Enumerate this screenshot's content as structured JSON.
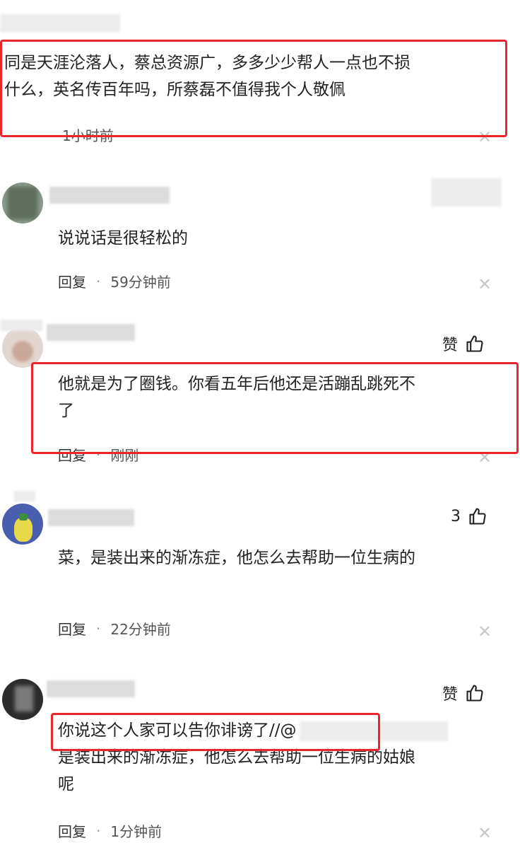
{
  "comments": [
    {
      "text": "同是天涯沦落人，蔡总资源广，多多少少帮人一点也不损什么，英名传百年吗，所蔡磊不值得我个人敬佩",
      "line1": "同是天涯沦落人，蔡总资源广，多多少少帮人一点也不损",
      "line2": "什么，英名传百年吗，所蔡磊不值得我个人敬佩",
      "time": "1小时前",
      "highlighted": true
    },
    {
      "text": "说说话是很轻松的",
      "reply": "回复",
      "time": "59分钟前"
    },
    {
      "like_label": "赞",
      "line1": "他就是为了圈钱。你看五年后他还是活蹦乱跳死不",
      "line2": "了",
      "reply": "回复",
      "time": "刚刚",
      "highlighted": true
    },
    {
      "like_count": "3",
      "text": "菜，是装出来的渐冻症，他怎么去帮助一位生病的",
      "reply": "回复",
      "time": "22分钟前"
    },
    {
      "like_label": "赞",
      "reply_prefix": "你说这个人家可以告你诽谤了//@",
      "line2": "是装出来的渐冻症，他怎么去帮助一位生病的姑娘",
      "line3": "呢",
      "reply": "回复",
      "time": "1分钟前",
      "highlighted": true
    }
  ],
  "colors": {
    "highlight_border": "#e8262b",
    "text": "#222222",
    "meta": "#555555",
    "close": "#c8c8c8"
  },
  "icons": {
    "like": "thumbs-up-icon",
    "close": "close-icon"
  }
}
